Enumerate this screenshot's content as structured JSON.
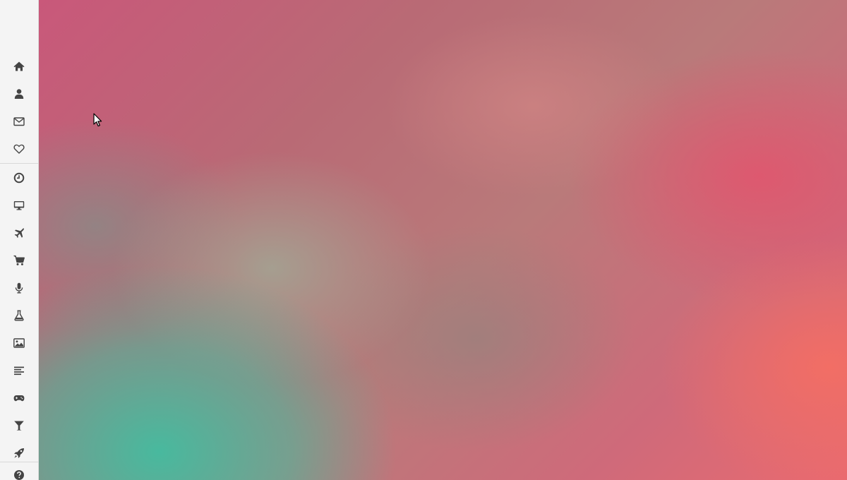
{
  "background": {
    "description_colors": [
      "#c9587a",
      "#42bda0",
      "#e96a70",
      "#f36e64"
    ]
  },
  "sidebar": {
    "icon_color": "#444444",
    "top_items": [
      {
        "icon": "home-icon"
      },
      {
        "icon": "user-icon"
      },
      {
        "icon": "envelope-icon"
      },
      {
        "icon": "heart-icon"
      }
    ],
    "app_items": [
      {
        "icon": "clock-icon"
      },
      {
        "icon": "desktop-icon"
      },
      {
        "icon": "plane-icon"
      },
      {
        "icon": "shopping-cart-icon"
      },
      {
        "icon": "microphone-icon"
      },
      {
        "icon": "flask-icon"
      },
      {
        "icon": "image-icon"
      },
      {
        "icon": "align-left-icon"
      },
      {
        "icon": "gamepad-icon"
      },
      {
        "icon": "filter-icon"
      },
      {
        "icon": "rocket-icon"
      }
    ],
    "bottom_items": [
      {
        "icon": "question-circle-icon"
      }
    ]
  }
}
